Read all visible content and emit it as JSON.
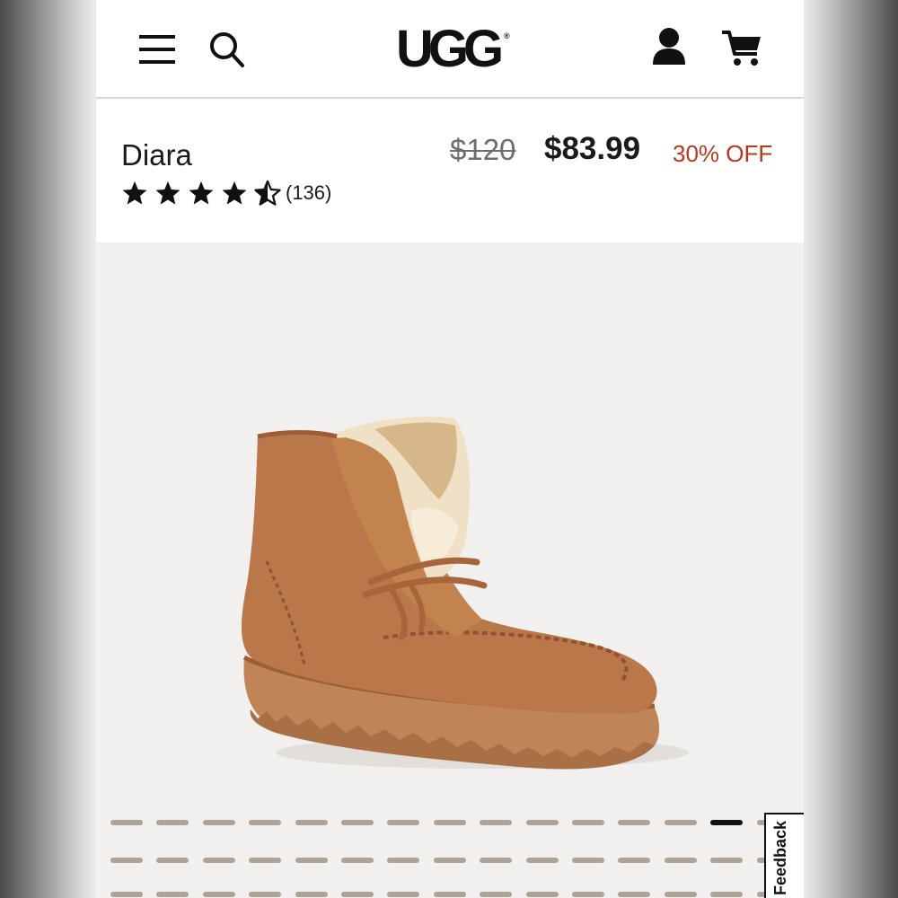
{
  "header": {
    "menu_icon": "hamburger-menu-icon",
    "search_icon": "search-icon",
    "logo_text": "UGG",
    "logo_mark": "®",
    "account_icon": "user-account-icon",
    "cart_icon": "shopping-cart-icon"
  },
  "product": {
    "name": "Diara",
    "rating": {
      "value": 4.5,
      "max": 5,
      "count_label": "(136)"
    },
    "original_price": "$120",
    "sale_price": "$83.99",
    "discount_label": "30% OFF",
    "image": "chestnut-suede-lace-up-boot"
  },
  "carousel": {
    "rows": 3,
    "dots_per_row": 15,
    "active_row": 1,
    "active_index": 14
  },
  "feedback": {
    "label": "Feedback"
  },
  "colors": {
    "discount": "#b5391c",
    "page_bg": "#f1f0ee",
    "dot": "#ada397",
    "dot_active": "#111111",
    "boot_suede": "#b9774a",
    "shearling": "#efe0c6"
  }
}
